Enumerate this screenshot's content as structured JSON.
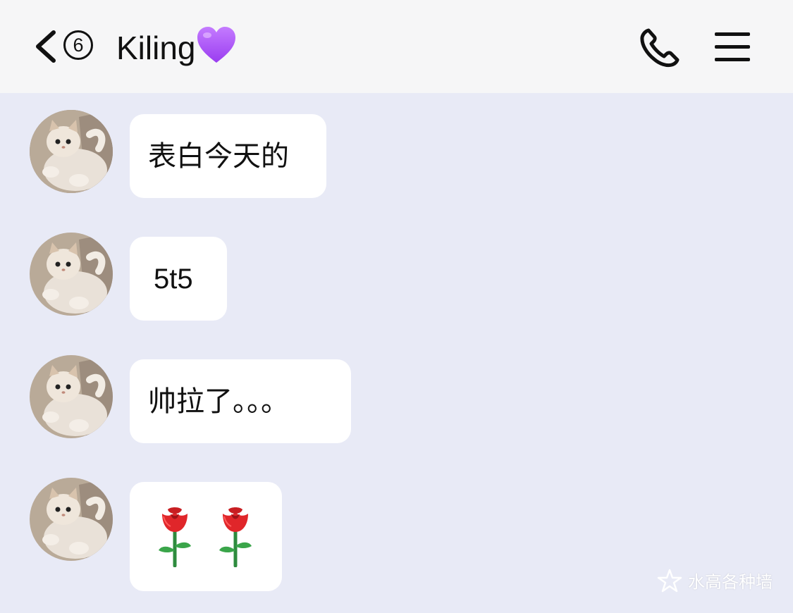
{
  "header": {
    "badge_count": "6",
    "contact_name": "Kiling",
    "heart_icon": "purple-heart-icon",
    "call_icon": "phone-icon",
    "menu_icon": "hamburger-menu-icon"
  },
  "messages": [
    {
      "text": "表白今天的",
      "avatar": "cat-avatar"
    },
    {
      "text": "5t5",
      "avatar": "cat-avatar"
    },
    {
      "text": "帅拉了。。。",
      "avatar": "cat-avatar"
    },
    {
      "text": "",
      "emoji": [
        "rose-icon",
        "rose-icon"
      ],
      "avatar": "cat-avatar"
    }
  ],
  "watermark": {
    "text": "水高各种墙",
    "icon": "star-icon"
  },
  "colors": {
    "header_bg": "#f6f6f7",
    "chat_bg": "#e8eaf6",
    "bubble_bg": "#ffffff",
    "heart": "#a855f7"
  }
}
